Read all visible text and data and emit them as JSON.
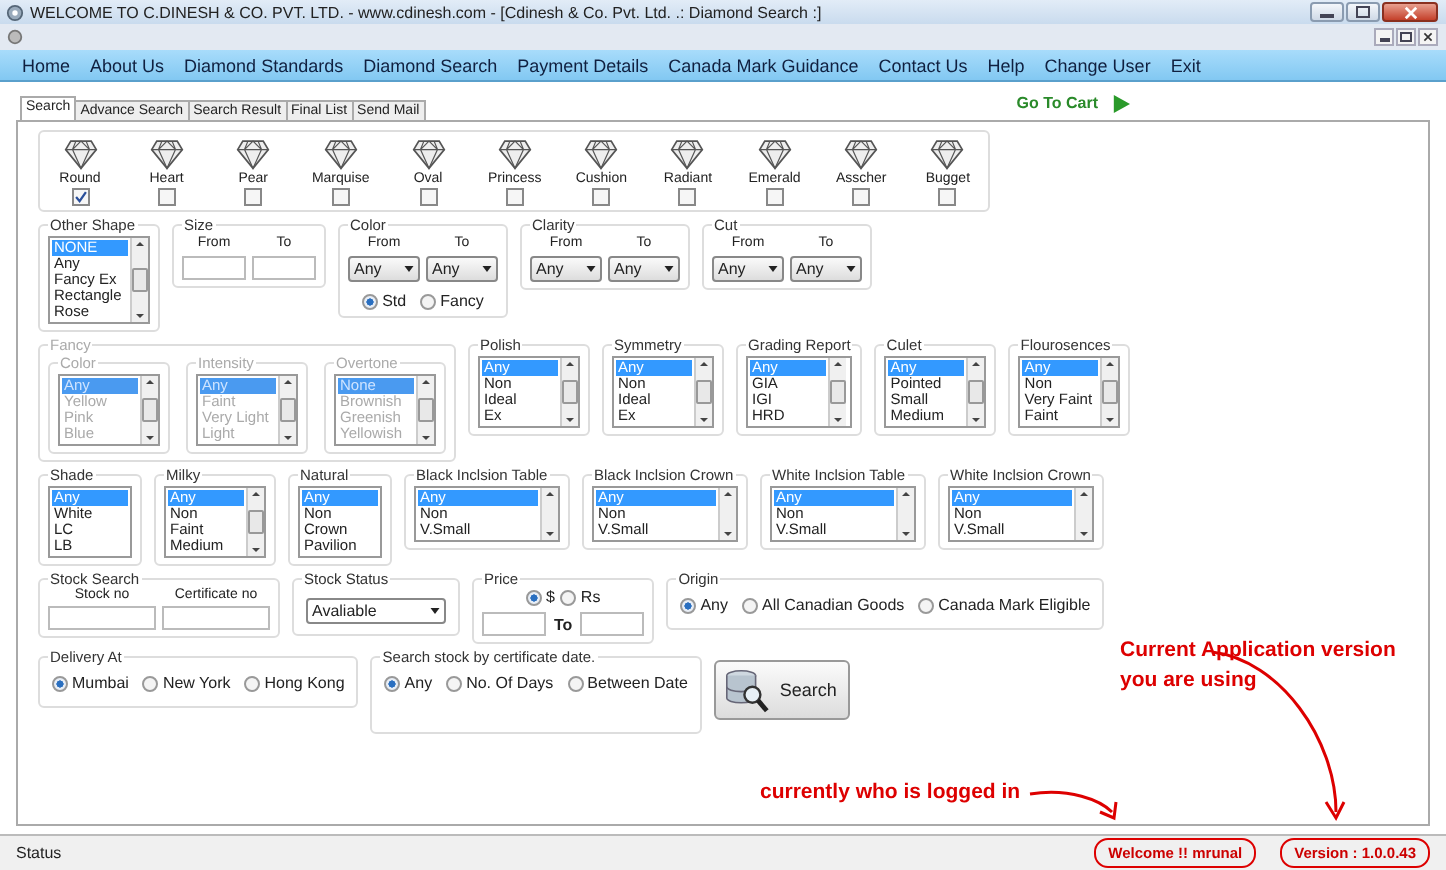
{
  "window": {
    "title": "WELCOME TO C.DINESH & CO. PVT. LTD. - www.cdinesh.com - [Cdinesh & Co. Pvt. Ltd. .: Diamond Search :]"
  },
  "menu": [
    "Home",
    "About Us",
    "Diamond Standards",
    "Diamond Search",
    "Payment Details",
    "Canada Mark Guidance",
    "Contact Us",
    "Help",
    "Change User",
    "Exit"
  ],
  "tabs": [
    {
      "label": "Search",
      "selected": true
    },
    {
      "label": "Advance Search",
      "selected": false
    },
    {
      "label": "Search Result",
      "selected": false
    },
    {
      "label": "Final List",
      "selected": false
    },
    {
      "label": "Send Mail",
      "selected": false
    }
  ],
  "go_to_cart": "Go To Cart",
  "shapes": [
    {
      "label": "Round",
      "checked": true
    },
    {
      "label": "Heart",
      "checked": false
    },
    {
      "label": "Pear",
      "checked": false
    },
    {
      "label": "Marquise",
      "checked": false
    },
    {
      "label": "Oval",
      "checked": false
    },
    {
      "label": "Princess",
      "checked": false
    },
    {
      "label": "Cushion",
      "checked": false
    },
    {
      "label": "Radiant",
      "checked": false
    },
    {
      "label": "Emerald",
      "checked": false
    },
    {
      "label": "Asscher",
      "checked": false
    },
    {
      "label": "Bugget",
      "checked": false
    }
  ],
  "rows": [
    {
      "groups": [
        {
          "kind": "listbox",
          "title": "Other Shape",
          "items": [
            {
              "label": "NONE",
              "selected": true
            },
            {
              "label": "Any",
              "selected": false
            },
            {
              "label": "Fancy Ex",
              "selected": false
            },
            {
              "label": "Rectangle",
              "selected": false
            },
            {
              "label": "Rose",
              "selected": false
            }
          ]
        },
        {
          "kind": "range_input",
          "title": "Size",
          "from_label": "From",
          "to_label": "To"
        },
        {
          "kind": "range_select",
          "title": "Color",
          "from_label": "From",
          "to_label": "To",
          "from_value": "Any",
          "to_value": "Any",
          "options": [
            {
              "label": "Std",
              "selected": true
            },
            {
              "label": "Fancy",
              "selected": false
            }
          ]
        },
        {
          "kind": "range_select",
          "title": "Clarity",
          "from_label": "From",
          "to_label": "To",
          "from_value": "Any",
          "to_value": "Any"
        },
        {
          "kind": "range_select",
          "title": "Cut",
          "from_label": "From",
          "to_label": "To",
          "from_value": "Any",
          "to_value": "Any"
        }
      ]
    },
    {
      "groups": [
        {
          "kind": "group",
          "title": "Fancy",
          "disabled": true,
          "groups": [
            {
              "title": "Color",
              "items": [
                {
                  "label": "Any",
                  "selected": true
                },
                {
                  "label": "Yellow",
                  "selected": false
                },
                {
                  "label": "Pink",
                  "selected": false
                },
                {
                  "label": "Blue",
                  "selected": false
                }
              ]
            },
            {
              "title": "Intensity",
              "items": [
                {
                  "label": "Any",
                  "selected": true
                },
                {
                  "label": "Faint",
                  "selected": false
                },
                {
                  "label": "Very Light",
                  "selected": false
                },
                {
                  "label": "Light",
                  "selected": false
                }
              ]
            },
            {
              "title": "Overtone",
              "items": [
                {
                  "label": "None",
                  "selected": true
                },
                {
                  "label": "Brownish",
                  "selected": false
                },
                {
                  "label": "Greenish",
                  "selected": false
                },
                {
                  "label": "Yellowish",
                  "selected": false
                }
              ]
            }
          ]
        },
        {
          "kind": "listbox",
          "title": "Polish",
          "items": [
            {
              "label": "Any",
              "selected": true
            },
            {
              "label": "Non",
              "selected": false
            },
            {
              "label": "Ideal",
              "selected": false
            },
            {
              "label": "Ex",
              "selected": false
            }
          ]
        },
        {
          "kind": "listbox",
          "title": "Symmetry",
          "items": [
            {
              "label": "Any",
              "selected": true
            },
            {
              "label": "Non",
              "selected": false
            },
            {
              "label": "Ideal",
              "selected": false
            },
            {
              "label": "Ex",
              "selected": false
            }
          ]
        },
        {
          "kind": "listbox",
          "title": "Grading Report",
          "items": [
            {
              "label": "Any",
              "selected": true
            },
            {
              "label": "GIA",
              "selected": false
            },
            {
              "label": "IGI",
              "selected": false
            },
            {
              "label": "HRD",
              "selected": false
            }
          ]
        },
        {
          "kind": "listbox",
          "title": "Culet",
          "items": [
            {
              "label": "Any",
              "selected": true
            },
            {
              "label": "Pointed",
              "selected": false
            },
            {
              "label": "Small",
              "selected": false
            },
            {
              "label": "Medium",
              "selected": false
            }
          ]
        },
        {
          "kind": "listbox",
          "title": "Flourosences",
          "items": [
            {
              "label": "Any",
              "selected": true
            },
            {
              "label": "Non",
              "selected": false
            },
            {
              "label": "Very Faint",
              "selected": false
            },
            {
              "label": "Faint",
              "selected": false
            }
          ]
        }
      ]
    },
    {
      "groups": [
        {
          "kind": "plain_list",
          "title": "Shade",
          "items": [
            {
              "label": "Any",
              "selected": true
            },
            {
              "label": "White",
              "selected": false
            },
            {
              "label": "LC",
              "selected": false
            },
            {
              "label": "LB",
              "selected": false
            }
          ]
        },
        {
          "kind": "listbox",
          "title": "Milky",
          "items": [
            {
              "label": "Any",
              "selected": true
            },
            {
              "label": "Non",
              "selected": false
            },
            {
              "label": "Faint",
              "selected": false
            },
            {
              "label": "Medium",
              "selected": false
            }
          ]
        },
        {
          "kind": "plain_list",
          "title": "Natural",
          "items": [
            {
              "label": "Any",
              "selected": true
            },
            {
              "label": "Non",
              "selected": false
            },
            {
              "label": "Crown",
              "selected": false
            },
            {
              "label": "Pavilion",
              "selected": false
            }
          ]
        },
        {
          "kind": "wide_listbox",
          "title": "Black Inclsion Table",
          "items": [
            {
              "label": "Any",
              "selected": true
            },
            {
              "label": "Non",
              "selected": false
            },
            {
              "label": "V.Small",
              "selected": false
            }
          ]
        },
        {
          "kind": "wide_listbox",
          "title": "Black Inclsion Crown",
          "items": [
            {
              "label": "Any",
              "selected": true
            },
            {
              "label": "Non",
              "selected": false
            },
            {
              "label": "V.Small",
              "selected": false
            }
          ]
        },
        {
          "kind": "wide_listbox",
          "title": "White Inclsion Table",
          "items": [
            {
              "label": "Any",
              "selected": true
            },
            {
              "label": "Non",
              "selected": false
            },
            {
              "label": "V.Small",
              "selected": false
            }
          ]
        },
        {
          "kind": "wide_listbox",
          "title": "White Inclsion Crown",
          "items": [
            {
              "label": "Any",
              "selected": true
            },
            {
              "label": "Non",
              "selected": false
            },
            {
              "label": "V.Small",
              "selected": false
            }
          ]
        }
      ]
    },
    {
      "groups": [
        {
          "kind": "inputs",
          "title": "Stock Search",
          "fields": [
            {
              "label": "Stock no"
            },
            {
              "label": "Certificate no"
            }
          ]
        },
        {
          "kind": "select",
          "title": "Stock Status",
          "value": "Avaliable"
        },
        {
          "kind": "price",
          "title": "Price",
          "options": [
            {
              "label": "$",
              "selected": true
            },
            {
              "label": "Rs",
              "selected": false
            }
          ],
          "to_label": "To"
        },
        {
          "kind": "radios",
          "title": "Origin",
          "options": [
            {
              "label": "Any",
              "selected": true
            },
            {
              "label": "All Canadian Goods",
              "selected": false
            },
            {
              "label": "Canada Mark Eligible",
              "selected": false
            }
          ]
        }
      ]
    },
    {
      "groups": [
        {
          "kind": "radios",
          "title": "Delivery At",
          "options": [
            {
              "label": "Mumbai",
              "selected": true
            },
            {
              "label": "New York",
              "selected": false
            },
            {
              "label": "Hong Kong",
              "selected": false
            }
          ]
        },
        {
          "kind": "radios",
          "title": "Search stock by certificate date.",
          "tall": true,
          "options": [
            {
              "label": "Any",
              "selected": true
            },
            {
              "label": "No. Of Days",
              "selected": false
            },
            {
              "label": "Between Date",
              "selected": false
            }
          ]
        },
        {
          "kind": "button",
          "label": "Search"
        }
      ]
    }
  ],
  "status": {
    "label": "Status",
    "user": "Welcome !! mrunal",
    "version": "Version : 1.0.0.43"
  },
  "annotations": [
    {
      "lines": [
        "Current Application version",
        "you are using"
      ]
    },
    {
      "lines": [
        "currently who is logged in"
      ]
    }
  ]
}
